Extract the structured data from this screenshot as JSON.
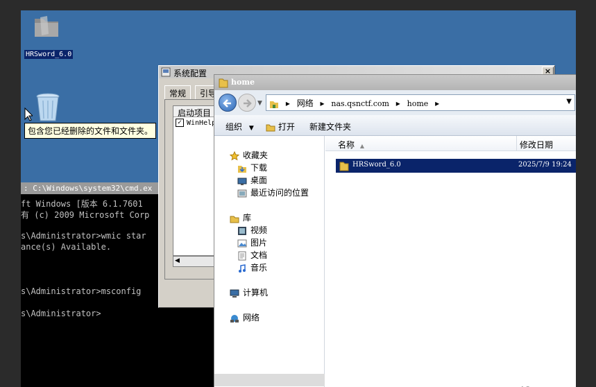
{
  "desktop": {
    "folder_label": "HRSword_6.0",
    "recycle_tooltip": "包含您已经删除的文件和文件夹。"
  },
  "cmd": {
    "title": ": C:\\Windows\\system32\\cmd.ex",
    "lines": [
      "ft Windows [版本 6.1.7601",
      "有 (c) 2009 Microsoft Corp",
      "",
      "s\\Administrator>wmic star",
      "ance(s) Available.",
      "",
      "",
      "",
      "s\\Administrator>msconfig",
      "",
      "s\\Administrator>"
    ]
  },
  "msconfig": {
    "title": "系统配置",
    "close": "×",
    "tabs": [
      "常规",
      "引导"
    ],
    "list_header": "启动项目",
    "row_check": "✓",
    "row_label": "WinHelp",
    "scroll_left": "◀"
  },
  "explorer": {
    "title": "home",
    "breadcrumb": [
      "网络",
      "nas.qsnctf.com",
      "home"
    ],
    "toolbar": {
      "organize": "组织",
      "open": "打开",
      "new_folder": "新建文件夹"
    },
    "nav": {
      "favorites": "收藏夹",
      "downloads": "下载",
      "desktop": "桌面",
      "recent": "最近访问的位置",
      "libraries": "库",
      "videos": "视频",
      "pictures": "图片",
      "documents": "文档",
      "music": "音乐",
      "computer": "计算机",
      "network": "网络"
    },
    "columns": {
      "name": "名称",
      "modified": "修改日期"
    },
    "files": [
      {
        "name": "HRSword_6.0",
        "modified": "2025/7/9 19:24"
      }
    ]
  },
  "colors": {
    "desktop_bg": "#3a6ea5",
    "selection": "#0a246a"
  }
}
